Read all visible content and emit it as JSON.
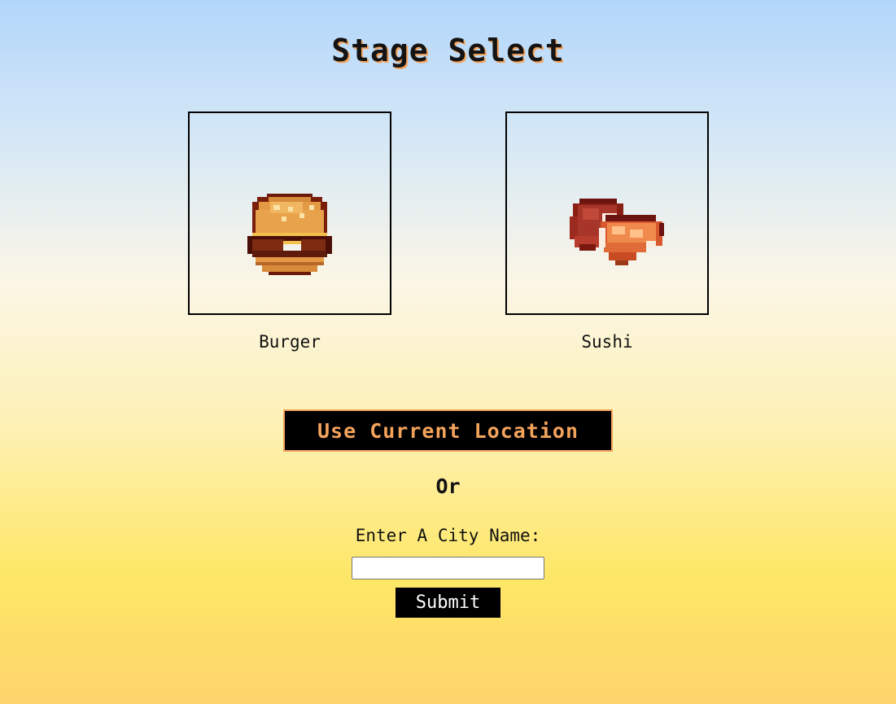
{
  "header": {
    "title": "Stage Select"
  },
  "stages": [
    {
      "label": "Burger",
      "icon": "burger-icon"
    },
    {
      "label": "Sushi",
      "icon": "sushi-icon"
    }
  ],
  "location": {
    "button_label": "Use Current Location"
  },
  "separator": {
    "text": "Or"
  },
  "city_form": {
    "label": "Enter A City Name:",
    "input_value": "",
    "submit_label": "Submit"
  },
  "colors": {
    "accent": "#f4a35c",
    "button_bg": "#000000",
    "gradient_top": "#b2d6fb",
    "gradient_bottom": "#fed46d"
  }
}
